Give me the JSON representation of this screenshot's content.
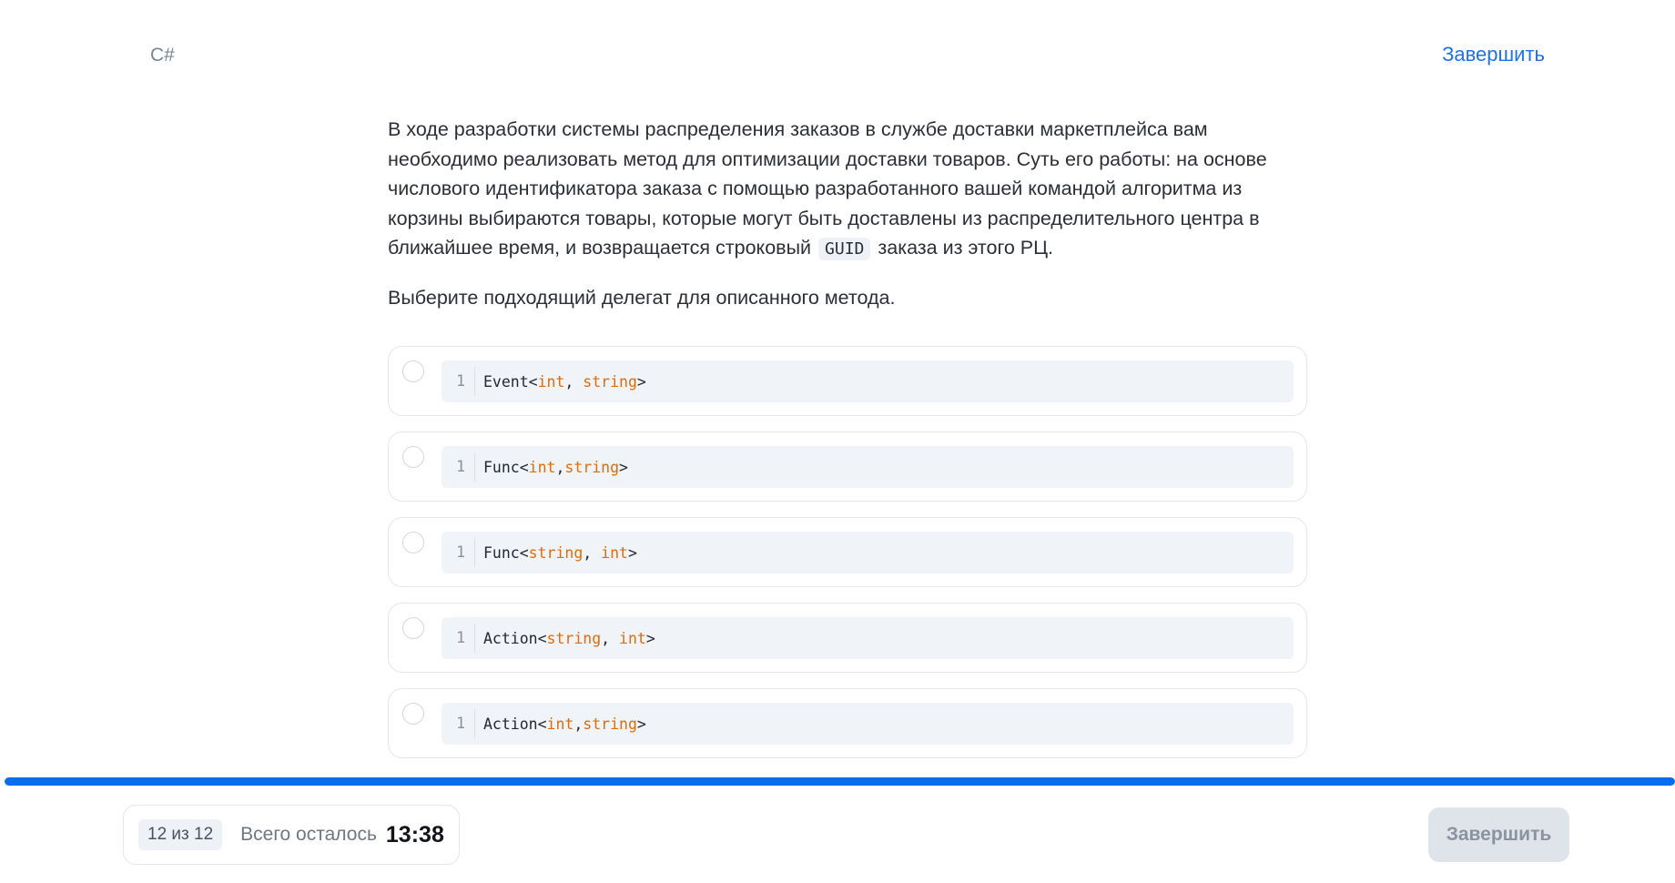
{
  "header": {
    "language": "C#",
    "finish_link": "Завершить"
  },
  "question": {
    "text_before_code": "В ходе разработки системы распределения заказов в службе доставки маркетплейса вам необходимо реализовать метод для оптимизации доставки товаров. Суть его работы: на основе числового идентификатора заказа с помощью разработанного вашей командой алгоритма из корзины выбираются товары, которые могут быть доставлены из распределительного центра в ближайшее время, и возвращается строковый",
    "inline_code": "GUID",
    "text_after_code": "заказа из этого РЦ.",
    "prompt": "Выберите подходящий делегат для описанного метода."
  },
  "options": [
    {
      "line_number": "1",
      "tokens": [
        {
          "t": "Event<",
          "c": "plain"
        },
        {
          "t": "int",
          "c": "kw"
        },
        {
          "t": ", ",
          "c": "plain"
        },
        {
          "t": "string",
          "c": "kw"
        },
        {
          "t": ">",
          "c": "plain"
        }
      ]
    },
    {
      "line_number": "1",
      "tokens": [
        {
          "t": "Func<",
          "c": "plain"
        },
        {
          "t": "int",
          "c": "kw"
        },
        {
          "t": ",",
          "c": "plain"
        },
        {
          "t": "string",
          "c": "kw"
        },
        {
          "t": ">",
          "c": "plain"
        }
      ]
    },
    {
      "line_number": "1",
      "tokens": [
        {
          "t": "Func<",
          "c": "plain"
        },
        {
          "t": "string",
          "c": "kw"
        },
        {
          "t": ", ",
          "c": "plain"
        },
        {
          "t": "int",
          "c": "kw"
        },
        {
          "t": ">",
          "c": "plain"
        }
      ]
    },
    {
      "line_number": "1",
      "tokens": [
        {
          "t": "Action<",
          "c": "plain"
        },
        {
          "t": "string",
          "c": "kw"
        },
        {
          "t": ", ",
          "c": "plain"
        },
        {
          "t": "int",
          "c": "kw"
        },
        {
          "t": ">",
          "c": "plain"
        }
      ]
    },
    {
      "line_number": "1",
      "tokens": [
        {
          "t": "Action<",
          "c": "plain"
        },
        {
          "t": "int",
          "c": "kw"
        },
        {
          "t": ",",
          "c": "plain"
        },
        {
          "t": "string",
          "c": "kw"
        },
        {
          "t": ">",
          "c": "plain"
        }
      ]
    }
  ],
  "footer": {
    "counter": "12 из 12",
    "time_label": "Всего осталось",
    "time_value": "13:38",
    "finish_button": "Завершить",
    "progress_fraction": 1.0
  },
  "colors": {
    "accent": "#1a73e8",
    "progress": "#0a6cf0",
    "keyword": "#e06c0a"
  }
}
